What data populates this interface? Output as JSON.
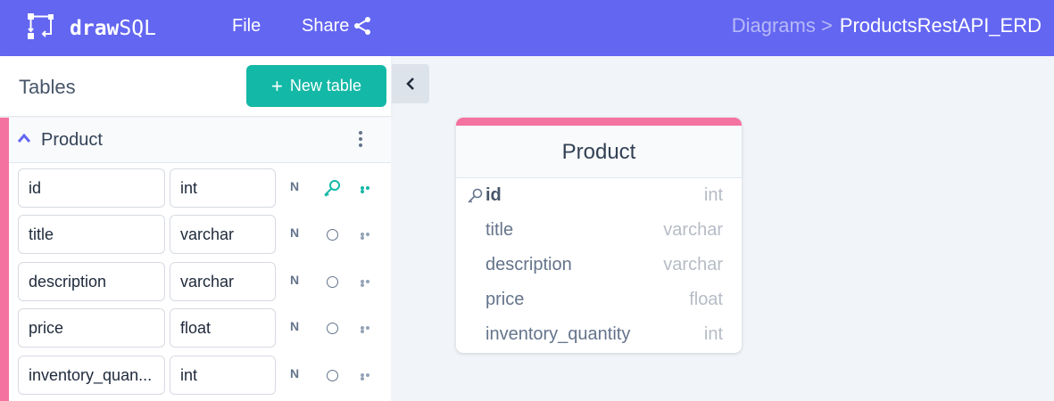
{
  "header": {
    "brand_bold": "draw",
    "brand_light": "SQL",
    "menu_file": "File",
    "menu_share": "Share",
    "breadcrumb_parent": "Diagrams >",
    "breadcrumb_current": "ProductsRestAPI_ERD",
    "icons": [
      "drawsql-logo-icon",
      "share-icon"
    ]
  },
  "sidebar": {
    "title": "Tables",
    "new_table_label": "New table",
    "table_name": "Product",
    "columns": [
      {
        "name": "id",
        "type": "int",
        "nullable": "N",
        "primary": true
      },
      {
        "name": "title",
        "type": "varchar",
        "nullable": "N",
        "primary": false
      },
      {
        "name": "description",
        "type": "varchar",
        "nullable": "N",
        "primary": false
      },
      {
        "name": "price",
        "type": "float",
        "nullable": "N",
        "primary": false
      },
      {
        "name": "inventory_quan...",
        "type": "int",
        "nullable": "N",
        "primary": false
      }
    ]
  },
  "erd": {
    "table_name": "Product",
    "accent_color": "#f472a0",
    "columns": [
      {
        "name": "id",
        "type": "int"
      },
      {
        "name": "title",
        "type": "varchar"
      },
      {
        "name": "description",
        "type": "varchar"
      },
      {
        "name": "price",
        "type": "float"
      },
      {
        "name": "inventory_quantity",
        "type": "int"
      }
    ]
  },
  "colors": {
    "header": "#6366f1",
    "button": "#14b8a6",
    "accent": "#f472a0"
  }
}
